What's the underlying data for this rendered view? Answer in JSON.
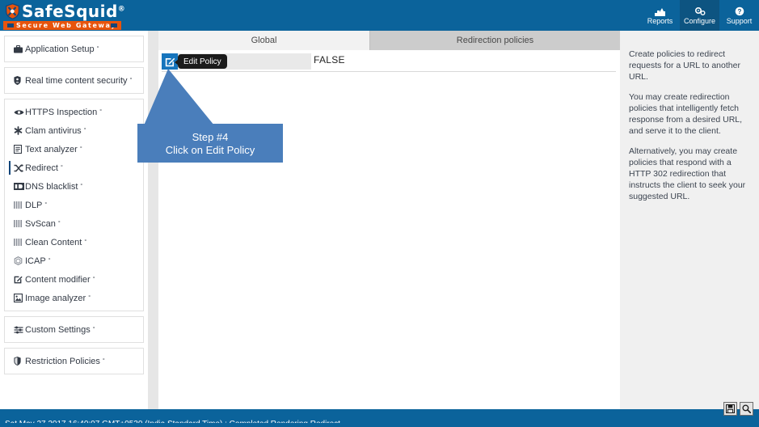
{
  "header": {
    "logo": {
      "name": "SafeSquid",
      "registered": "®",
      "tagline": "Secure Web Gateway",
      "shield_icon": "shield-tools-icon"
    },
    "nav": [
      {
        "label": "Reports",
        "icon": "chart-icon",
        "glyph": "ᴸ▰",
        "active": false
      },
      {
        "label": "Configure",
        "icon": "gears-icon",
        "glyph": "⚙",
        "active": true
      },
      {
        "label": "Support",
        "icon": "help-circle-icon",
        "glyph": "❓",
        "active": false
      }
    ]
  },
  "sidebar": {
    "groups": [
      {
        "items": [
          {
            "label": "Application Setup",
            "icon": "briefcase-icon",
            "glyph": "💼",
            "badge": "°",
            "active": false
          }
        ]
      },
      {
        "items": [
          {
            "label": "Real time content security",
            "icon": "shield-person-icon",
            "glyph": "♟",
            "badge": "°",
            "active": false
          }
        ]
      },
      {
        "items": [
          {
            "label": "HTTPS Inspection",
            "icon": "eye-icon",
            "glyph": "◉",
            "badge": "°",
            "active": false
          },
          {
            "label": "Clam antivirus",
            "icon": "asterisk-icon",
            "glyph": "✹",
            "badge": "°",
            "active": false
          },
          {
            "label": "Text analyzer",
            "icon": "document-icon",
            "glyph": "▤",
            "badge": "°",
            "active": false
          },
          {
            "label": "Redirect",
            "icon": "shuffle-icon",
            "glyph": "⤨",
            "badge": "°",
            "active": true
          },
          {
            "label": "DNS blacklist",
            "icon": "blacklist-icon",
            "glyph": "■",
            "badge": "°",
            "active": false
          },
          {
            "label": "DLP",
            "icon": "bars-icon",
            "glyph": "⫿ff",
            "badge": "°",
            "active": false
          },
          {
            "label": "SvScan",
            "icon": "bars-icon",
            "glyph": "‖‖",
            "badge": "°",
            "active": false
          },
          {
            "label": "Clean Content",
            "icon": "bars-icon",
            "glyph": "‖‖",
            "badge": "°",
            "active": false
          },
          {
            "label": "ICAP",
            "icon": "hexagon-icon",
            "glyph": "⬡",
            "badge": "°",
            "active": false
          },
          {
            "label": "Content modifier",
            "icon": "edit-square-icon",
            "glyph": "✎",
            "badge": "°",
            "active": false
          },
          {
            "label": "Image analyzer",
            "icon": "image-icon",
            "glyph": "▣",
            "badge": "°",
            "active": false
          }
        ]
      },
      {
        "items": [
          {
            "label": "Custom Settings",
            "icon": "sliders-icon",
            "glyph": "≡",
            "badge": "°",
            "active": false
          }
        ]
      },
      {
        "items": [
          {
            "label": "Restriction Policies",
            "icon": "shield-icon",
            "glyph": "⛊",
            "badge": "°",
            "active": false
          }
        ]
      }
    ]
  },
  "main": {
    "tabs": [
      {
        "label": "Global",
        "active": false
      },
      {
        "label": "Redirection policies",
        "active": true
      }
    ],
    "policy_row": {
      "edit_icon": "edit-square-icon",
      "tooltip": "Edit Policy",
      "value": "FALSE"
    }
  },
  "callout": {
    "line1": "Step #4",
    "line2": "Click on Edit Policy",
    "color": "#4a7ebb"
  },
  "help": {
    "paragraphs": [
      "Create policies to redirect requests for a URL to another URL.",
      "You may create redirection policies that intelligently fetch response from a desired URL, and serve it to the client.",
      "Alternatively, you may create policies that respond with a HTTP 302 redirection that instructs the client to seek your suggested URL."
    ]
  },
  "statusbar": {
    "message": "Sat May 27 2017 16:40:07 GMT+0530 (India Standard Time) : Completed Rendering Redirect",
    "buttons": [
      {
        "label": "💾",
        "icon": "save-icon"
      },
      {
        "label": "🔍",
        "icon": "search-icon"
      }
    ]
  },
  "colors": {
    "header_blue": "#0b639b",
    "accent_orange": "#e8540c",
    "active_nav": "#0d5481",
    "callout_blue": "#4a7ebb",
    "edit_button_blue": "#1675bd"
  }
}
